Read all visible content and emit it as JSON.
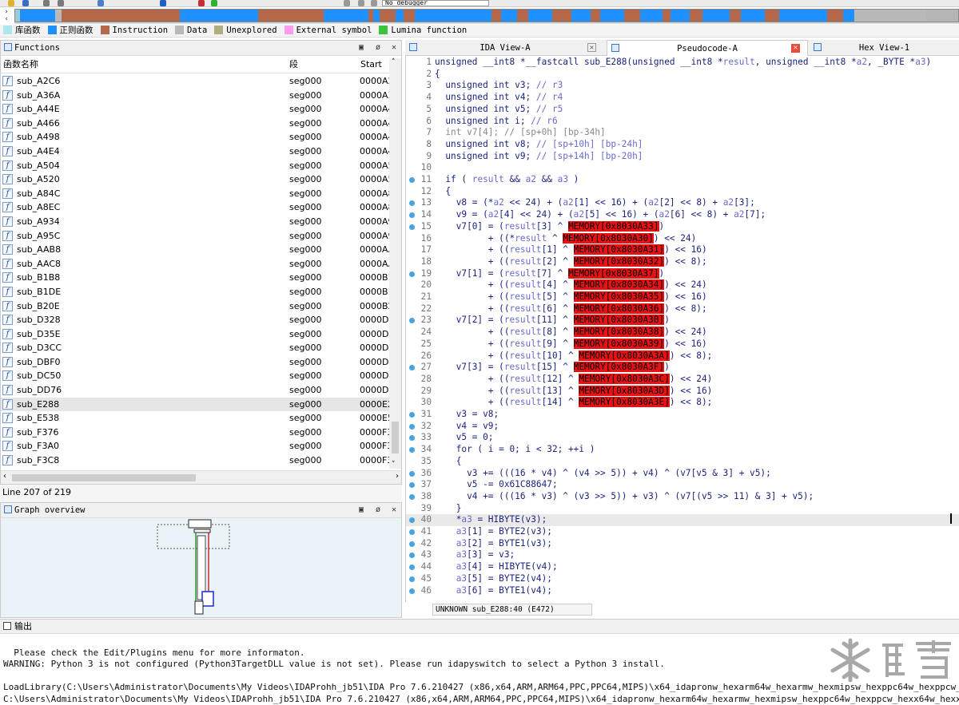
{
  "toolbar": {
    "debugger": "No debugger"
  },
  "legend": [
    {
      "label": "库函数",
      "color": "#aee8ef"
    },
    {
      "label": "正则函数",
      "color": "#1e90ff"
    },
    {
      "label": "Instruction",
      "color": "#b4684a"
    },
    {
      "label": "Data",
      "color": "#b9b9b9"
    },
    {
      "label": "Unexplored",
      "color": "#aeae80"
    },
    {
      "label": "External symbol",
      "color": "#ff9cf0"
    },
    {
      "label": "Lumina function",
      "color": "#3cc43c"
    }
  ],
  "functions": {
    "title": "Functions",
    "col_name": "函数名称",
    "col_seg": "段",
    "col_start": "Start",
    "rows": [
      {
        "name": "sub_A2C6",
        "seg": "seg000",
        "start": "0000A2"
      },
      {
        "name": "sub_A36A",
        "seg": "seg000",
        "start": "0000A3"
      },
      {
        "name": "sub_A44E",
        "seg": "seg000",
        "start": "0000A4"
      },
      {
        "name": "sub_A466",
        "seg": "seg000",
        "start": "0000A4"
      },
      {
        "name": "sub_A498",
        "seg": "seg000",
        "start": "0000A4"
      },
      {
        "name": "sub_A4E4",
        "seg": "seg000",
        "start": "0000A4"
      },
      {
        "name": "sub_A504",
        "seg": "seg000",
        "start": "0000A5"
      },
      {
        "name": "sub_A520",
        "seg": "seg000",
        "start": "0000A5"
      },
      {
        "name": "sub_A84C",
        "seg": "seg000",
        "start": "0000A8"
      },
      {
        "name": "sub_A8EC",
        "seg": "seg000",
        "start": "0000A8"
      },
      {
        "name": "sub_A934",
        "seg": "seg000",
        "start": "0000A9"
      },
      {
        "name": "sub_A95C",
        "seg": "seg000",
        "start": "0000A9"
      },
      {
        "name": "sub_AAB8",
        "seg": "seg000",
        "start": "0000AA"
      },
      {
        "name": "sub_AAC8",
        "seg": "seg000",
        "start": "0000AA"
      },
      {
        "name": "sub_B1B8",
        "seg": "seg000",
        "start": "0000B1"
      },
      {
        "name": "sub_B1DE",
        "seg": "seg000",
        "start": "0000B1"
      },
      {
        "name": "sub_B20E",
        "seg": "seg000",
        "start": "0000B2"
      },
      {
        "name": "sub_D328",
        "seg": "seg000",
        "start": "0000D3"
      },
      {
        "name": "sub_D35E",
        "seg": "seg000",
        "start": "0000D3"
      },
      {
        "name": "sub_D3CC",
        "seg": "seg000",
        "start": "0000D3"
      },
      {
        "name": "sub_DBF0",
        "seg": "seg000",
        "start": "0000DB"
      },
      {
        "name": "sub_DC50",
        "seg": "seg000",
        "start": "0000DC"
      },
      {
        "name": "sub_DD76",
        "seg": "seg000",
        "start": "0000DD"
      },
      {
        "name": "sub_E288",
        "seg": "seg000",
        "start": "0000E2",
        "selected": true
      },
      {
        "name": "sub_E538",
        "seg": "seg000",
        "start": "0000E5"
      },
      {
        "name": "sub_F376",
        "seg": "seg000",
        "start": "0000F3"
      },
      {
        "name": "sub_F3A0",
        "seg": "seg000",
        "start": "0000F3"
      },
      {
        "name": "sub_F3C8",
        "seg": "seg000",
        "start": "0000F3"
      }
    ],
    "line_info": "Line 207 of 219"
  },
  "graph_overview": {
    "title": "Graph overview"
  },
  "tabs": [
    {
      "label": "IDA View-A",
      "active": false
    },
    {
      "label": "Pseudocode-A",
      "active": true
    },
    {
      "label": "Hex View-1",
      "active": false
    }
  ],
  "code": {
    "status": "UNKNOWN sub_E288:40 (E472)",
    "lines": [
      {
        "n": "1",
        "html": "unsigned __int8 *__fastcall sub_E288(unsigned __int8 *result, unsigned __int8 *a2, _BYTE *a3)",
        "dot": false
      },
      {
        "n": "2",
        "html": "{",
        "dot": false
      },
      {
        "n": "3",
        "html": "  unsigned int v3; // r3",
        "dot": false
      },
      {
        "n": "4",
        "html": "  unsigned int v4; // r4",
        "dot": false
      },
      {
        "n": "5",
        "html": "  unsigned int v5; // r5",
        "dot": false
      },
      {
        "n": "6",
        "html": "  unsigned int i; // r6",
        "dot": false
      },
      {
        "n": "7",
        "html": "  int v7[4]; // [sp+0h] [bp-34h]",
        "dot": false
      },
      {
        "n": "8",
        "html": "  unsigned int v8; // [sp+10h] [bp-24h]",
        "dot": false
      },
      {
        "n": "9",
        "html": "  unsigned int v9; // [sp+14h] [bp-20h]",
        "dot": false
      },
      {
        "n": "10",
        "html": "",
        "dot": false
      },
      {
        "n": "11",
        "html": "  if ( result && a2 && a3 )",
        "dot": true
      },
      {
        "n": "12",
        "html": "  {",
        "dot": false
      },
      {
        "n": "13",
        "html": "    v8 = (*a2 << 24) + (a2[1] << 16) + (a2[2] << 8) + a2[3];",
        "dot": true
      },
      {
        "n": "14",
        "html": "    v9 = (a2[4] << 24) + (a2[5] << 16) + (a2[6] << 8) + a2[7];",
        "dot": true
      },
      {
        "n": "15",
        "html": "    v7[0] = (result[3] ^ MEMORY[0x8030A33])",
        "dot": true
      },
      {
        "n": "16",
        "html": "          + ((*result ^ MEMORY[0x8030A30]) << 24)",
        "dot": false
      },
      {
        "n": "17",
        "html": "          + ((result[1] ^ MEMORY[0x8030A31]) << 16)",
        "dot": false
      },
      {
        "n": "18",
        "html": "          + ((result[2] ^ MEMORY[0x8030A32]) << 8);",
        "dot": false
      },
      {
        "n": "19",
        "html": "    v7[1] = (result[7] ^ MEMORY[0x8030A37])",
        "dot": true
      },
      {
        "n": "20",
        "html": "          + ((result[4] ^ MEMORY[0x8030A34]) << 24)",
        "dot": false
      },
      {
        "n": "21",
        "html": "          + ((result[5] ^ MEMORY[0x8030A35]) << 16)",
        "dot": false
      },
      {
        "n": "22",
        "html": "          + ((result[6] ^ MEMORY[0x8030A36]) << 8);",
        "dot": false
      },
      {
        "n": "23",
        "html": "    v7[2] = (result[11] ^ MEMORY[0x8030A3B])",
        "dot": true
      },
      {
        "n": "24",
        "html": "          + ((result[8] ^ MEMORY[0x8030A38]) << 24)",
        "dot": false
      },
      {
        "n": "25",
        "html": "          + ((result[9] ^ MEMORY[0x8030A39]) << 16)",
        "dot": false
      },
      {
        "n": "26",
        "html": "          + ((result[10] ^ MEMORY[0x8030A3A]) << 8);",
        "dot": false
      },
      {
        "n": "27",
        "html": "    v7[3] = (result[15] ^ MEMORY[0x8030A3F])",
        "dot": true
      },
      {
        "n": "28",
        "html": "          + ((result[12] ^ MEMORY[0x8030A3C]) << 24)",
        "dot": false
      },
      {
        "n": "29",
        "html": "          + ((result[13] ^ MEMORY[0x8030A3D]) << 16)",
        "dot": false
      },
      {
        "n": "30",
        "html": "          + ((result[14] ^ MEMORY[0x8030A3E]) << 8);",
        "dot": false
      },
      {
        "n": "31",
        "html": "    v3 = v8;",
        "dot": true
      },
      {
        "n": "32",
        "html": "    v4 = v9;",
        "dot": true
      },
      {
        "n": "33",
        "html": "    v5 = 0;",
        "dot": true
      },
      {
        "n": "34",
        "html": "    for ( i = 0; i < 32; ++i )",
        "dot": true
      },
      {
        "n": "35",
        "html": "    {",
        "dot": false
      },
      {
        "n": "36",
        "html": "      v3 += (((16 * v4) ^ (v4 >> 5)) + v4) ^ (v7[v5 & 3] + v5);",
        "dot": true
      },
      {
        "n": "37",
        "html": "      v5 -= 0x61C88647;",
        "dot": true
      },
      {
        "n": "38",
        "html": "      v4 += (((16 * v3) ^ (v3 >> 5)) + v3) ^ (v7[(v5 >> 11) & 3] + v5);",
        "dot": true
      },
      {
        "n": "39",
        "html": "    }",
        "dot": false
      },
      {
        "n": "40",
        "html": "    *a3 = HIBYTE(v3);",
        "dot": true,
        "current": true
      },
      {
        "n": "41",
        "html": "    a3[1] = BYTE2(v3);",
        "dot": true
      },
      {
        "n": "42",
        "html": "    a3[2] = BYTE1(v3);",
        "dot": true
      },
      {
        "n": "43",
        "html": "    a3[3] = v3;",
        "dot": true
      },
      {
        "n": "44",
        "html": "    a3[4] = HIBYTE(v4);",
        "dot": true
      },
      {
        "n": "45",
        "html": "    a3[5] = BYTE2(v4);",
        "dot": true
      },
      {
        "n": "46",
        "html": "    a3[6] = BYTE1(v4);",
        "dot": true
      }
    ]
  },
  "output": {
    "title": "输出",
    "lines": [
      "",
      "  Please check the Edit/Plugins menu for more informaton.",
      "WARNING: Python 3 is not configured (Python3TargetDLL value is not set). Please run idapyswitch to select a Python 3 install.",
      "",
      "LoadLibrary(C:\\Users\\Administrator\\Documents\\My Videos\\IDAProhh_jb51\\IDA Pro 7.6.210427 (x86,x64,ARM,ARM64,PPC,PPC64,MIPS)\\x64_idapronw_hexarm64w_hexarmw_hexmipsw_hexppc64w_hexppcw_",
      "C:\\Users\\Administrator\\Documents\\My Videos\\IDAProhh_jb51\\IDA Pro 7.6.210427 (x86,x64,ARM,ARM64,PPC,PPC64,MIPS)\\x64_idapronw_hexarm64w_hexarmw_hexmipsw_hexppc64w_hexppcw_hexx64w_hexx"
    ]
  },
  "watermark": "看雪"
}
